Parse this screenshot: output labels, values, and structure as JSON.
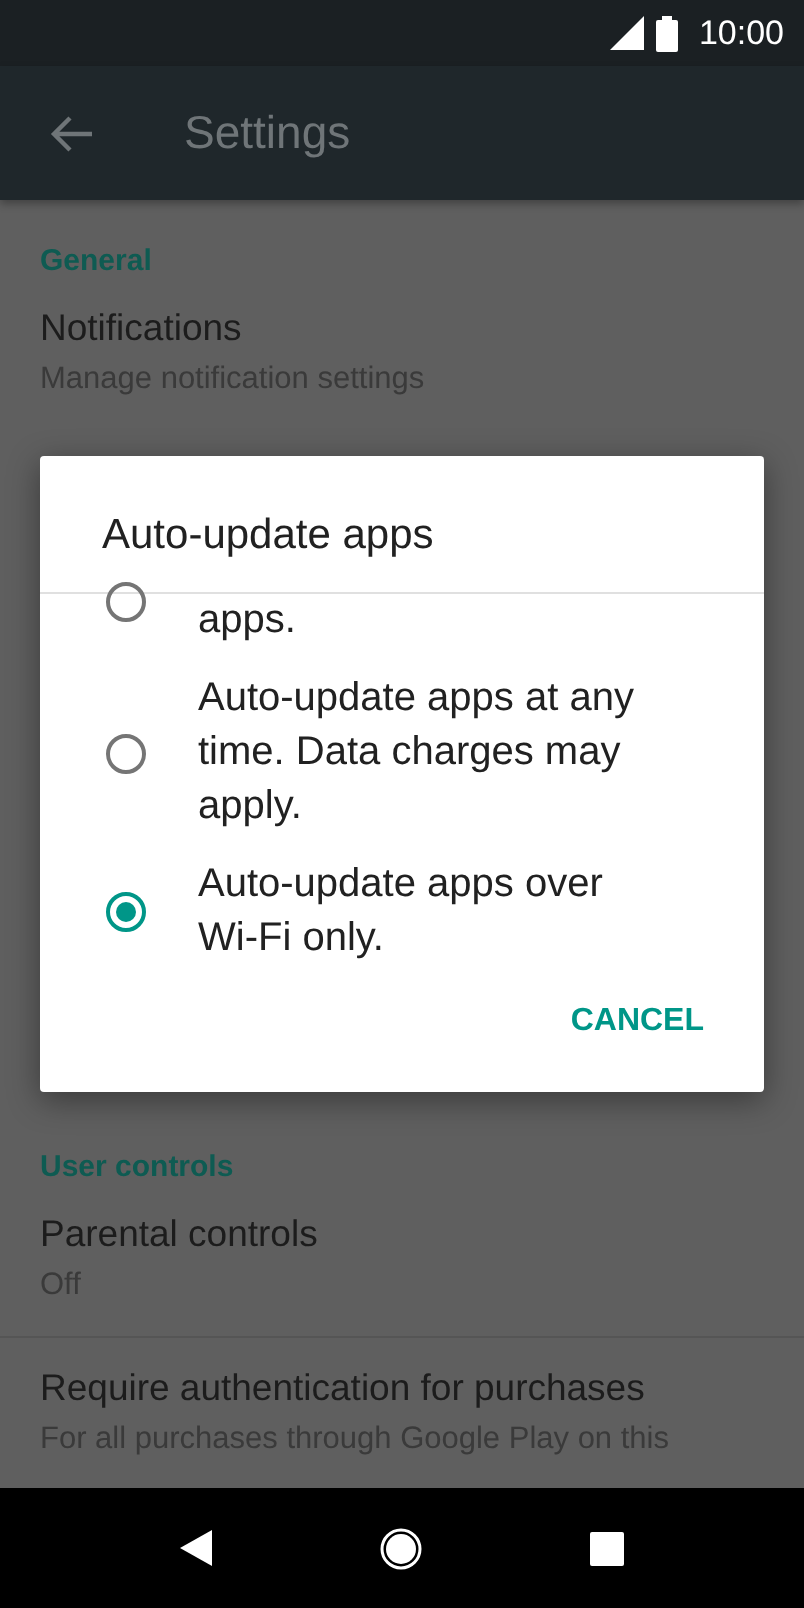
{
  "status_bar": {
    "time": "10:00"
  },
  "app_bar": {
    "title": "Settings"
  },
  "sections": [
    {
      "header": "General",
      "items": [
        {
          "title": "Notifications",
          "subtitle": "Manage notification settings"
        }
      ]
    },
    {
      "header": "User controls",
      "items": [
        {
          "title": "Parental controls",
          "subtitle": "Off"
        },
        {
          "title": "Require authentication for purchases",
          "subtitle": "For all purchases through Google Play on this"
        }
      ]
    }
  ],
  "dialog": {
    "title": "Auto-update apps",
    "options": [
      {
        "label": "apps.",
        "selected": false
      },
      {
        "label": "Auto-update apps at any time. Data charges may apply.",
        "selected": false
      },
      {
        "label": "Auto-update apps over Wi-Fi only.",
        "selected": true
      }
    ],
    "buttons": [
      "CANCEL"
    ]
  }
}
